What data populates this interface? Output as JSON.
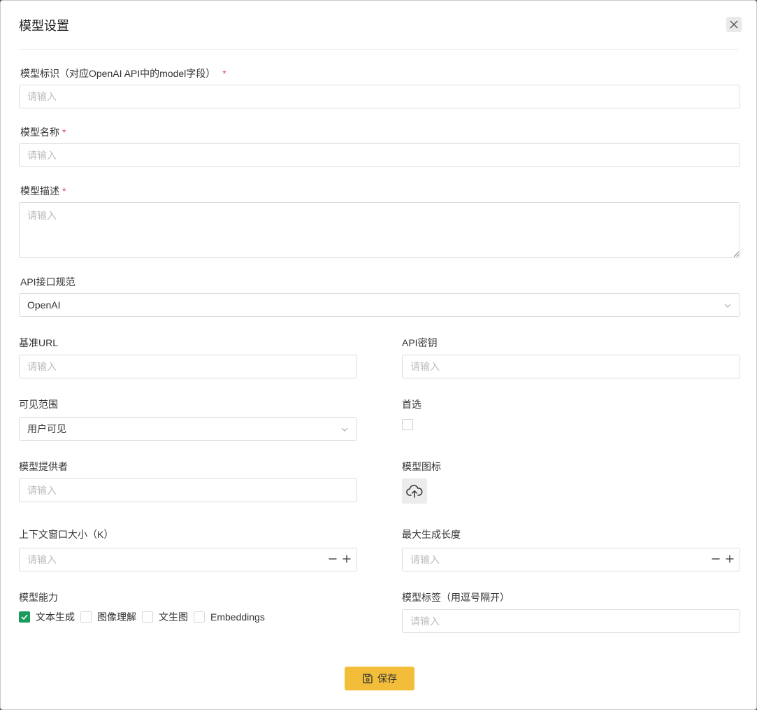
{
  "dialog": {
    "title": "模型设置"
  },
  "fields": {
    "model_id": {
      "label": "模型标识（对应OpenAI API中的model字段）",
      "placeholder": "请输入",
      "value": ""
    },
    "model_name": {
      "label": "模型名称",
      "placeholder": "请输入",
      "value": ""
    },
    "model_desc": {
      "label": "模型描述",
      "placeholder": "请输入",
      "value": ""
    },
    "api_spec": {
      "label": "API接口规范",
      "value": "OpenAI"
    },
    "base_url": {
      "label": "基准URL",
      "placeholder": "请输入",
      "value": ""
    },
    "api_key": {
      "label": "API密钥",
      "placeholder": "请输入",
      "value": ""
    },
    "visibility": {
      "label": "可见范围",
      "value": "用户可见"
    },
    "preferred": {
      "label": "首选",
      "checked": false
    },
    "provider": {
      "label": "模型提供者",
      "placeholder": "请输入",
      "value": ""
    },
    "icon": {
      "label": "模型图标"
    },
    "context_window": {
      "label": "上下文窗口大小（K）",
      "placeholder": "请输入",
      "value": ""
    },
    "max_gen_length": {
      "label": "最大生成长度",
      "placeholder": "请输入",
      "value": ""
    },
    "capabilities": {
      "label": "模型能力",
      "options": [
        {
          "label": "文本生成",
          "checked": true
        },
        {
          "label": "图像理解",
          "checked": false
        },
        {
          "label": "文生图",
          "checked": false
        },
        {
          "label": "Embeddings",
          "checked": false
        }
      ]
    },
    "tags": {
      "label": "模型标签（用逗号隔开）",
      "placeholder": "请输入",
      "value": ""
    }
  },
  "required_mark": "*",
  "actions": {
    "save_label": "保存"
  },
  "colors": {
    "accent": "#f2be3a",
    "checkbox_checked": "#1a9b5c",
    "required": "#e34d59"
  }
}
